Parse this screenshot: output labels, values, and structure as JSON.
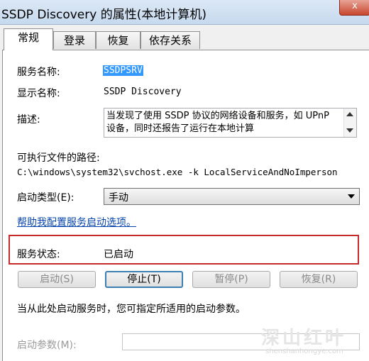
{
  "window": {
    "title": "SSDP Discovery 的属性(本地计算机)",
    "close_label": "x"
  },
  "tabs": [
    {
      "label": "常规"
    },
    {
      "label": "登录"
    },
    {
      "label": "恢复"
    },
    {
      "label": "依存关系"
    }
  ],
  "general": {
    "service_name_label": "服务名称:",
    "service_name_value": "SSDPSRV",
    "display_name_label": "显示名称:",
    "display_name_value": "SSDP Discovery",
    "description_label": "描述:",
    "description_text": "当发现了使用 SSDP 协议的网络设备和服务，如 UPnP 设备，同时还报告了运行在本地计算",
    "exe_path_label": "可执行文件的路径:",
    "exe_path_value": "C:\\windows\\system32\\svchost.exe -k LocalServiceAndNoImperson",
    "startup_type_label": "启动类型(E):",
    "startup_type_value": "手动",
    "help_link": "帮助我配置服务启动选项。",
    "status_label": "服务状态:",
    "status_value": "已启动",
    "buttons": {
      "start": "启动(S)",
      "stop": "停止(T)",
      "pause": "暂停(P)",
      "resume": "恢复(R)"
    },
    "hint": "当从此处启动服务时，您可指定所适用的启动参数。",
    "start_params_label": "启动参数(M):",
    "start_params_value": ""
  },
  "watermark": {
    "main": "深山红叶",
    "sub": "shenshanhongye.com"
  },
  "colors": {
    "selection": "#3399ff",
    "highlight_border": "#c62a2a",
    "link": "#0645ad"
  }
}
